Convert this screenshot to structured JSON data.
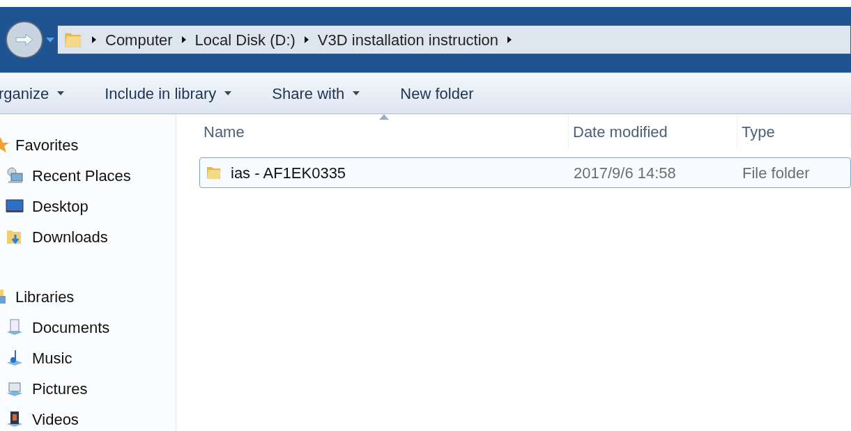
{
  "breadcrumb": [
    "Computer",
    "Local Disk (D:)",
    "V3D installation instruction"
  ],
  "toolbar": [
    {
      "label": "rganize",
      "menu": true
    },
    {
      "label": "Include in library",
      "menu": true
    },
    {
      "label": "Share with",
      "menu": true
    },
    {
      "label": "New folder",
      "menu": false
    }
  ],
  "sidebar": {
    "groups": [
      {
        "label": "Favorites",
        "kind": "favorites",
        "items": [
          {
            "label": "Recent Places",
            "kind": "recent"
          },
          {
            "label": "Desktop",
            "kind": "desktop"
          },
          {
            "label": "Downloads",
            "kind": "downloads"
          }
        ]
      },
      {
        "label": "Libraries",
        "kind": "libraries",
        "items": [
          {
            "label": "Documents",
            "kind": "documents"
          },
          {
            "label": "Music",
            "kind": "music"
          },
          {
            "label": "Pictures",
            "kind": "pictures"
          },
          {
            "label": "Videos",
            "kind": "videos"
          }
        ]
      }
    ]
  },
  "table": {
    "columns": [
      {
        "label": "Name",
        "sorted": true
      },
      {
        "label": "Date modified",
        "sorted": false
      },
      {
        "label": "Type",
        "sorted": false
      }
    ],
    "rows": [
      {
        "name": "ias - AF1EK0335",
        "date": "2017/9/6 14:58",
        "type": "File folder",
        "selected": true
      }
    ]
  }
}
